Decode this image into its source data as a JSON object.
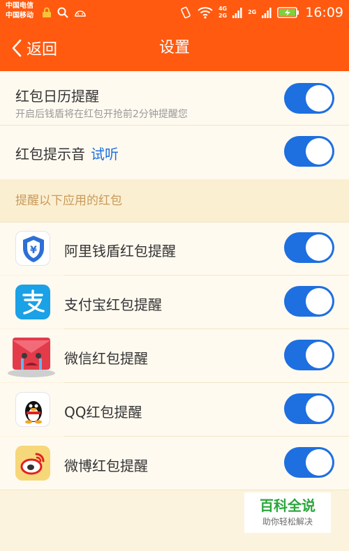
{
  "status_bar": {
    "carrier_1": "中国电信",
    "carrier_2": "中国移动",
    "net_4g": "4G",
    "net_2g_a": "2G",
    "net_2g_b": "2G",
    "time": "16:09"
  },
  "header": {
    "back_label": "返回",
    "title": "设置"
  },
  "settings": {
    "calendar_reminder": {
      "title": "红包日历提醒",
      "subtitle": "开启后钱盾将在红包开抢前2分钟提醒您",
      "enabled": true
    },
    "sound": {
      "title": "红包提示音",
      "listen_label": "试听",
      "enabled": true
    }
  },
  "section": {
    "title": "提醒以下应用的红包"
  },
  "apps": [
    {
      "label": "阿里钱盾红包提醒",
      "icon": "alibaba-qiandun-icon",
      "enabled": true
    },
    {
      "label": "支付宝红包提醒",
      "icon": "alipay-icon",
      "enabled": true
    },
    {
      "label": "微信红包提醒",
      "icon": "wechat-red-envelope-icon",
      "enabled": true
    },
    {
      "label": "QQ红包提醒",
      "icon": "qq-penguin-icon",
      "enabled": true
    },
    {
      "label": "微博红包提醒",
      "icon": "weibo-icon",
      "enabled": true
    }
  ],
  "watermark": {
    "main": "百科全说",
    "sub": "助你轻松解决"
  },
  "colors": {
    "accent_orange": "#ff5a0f",
    "toggle_blue": "#1e6fe0",
    "page_bg": "#fbf3dd"
  }
}
